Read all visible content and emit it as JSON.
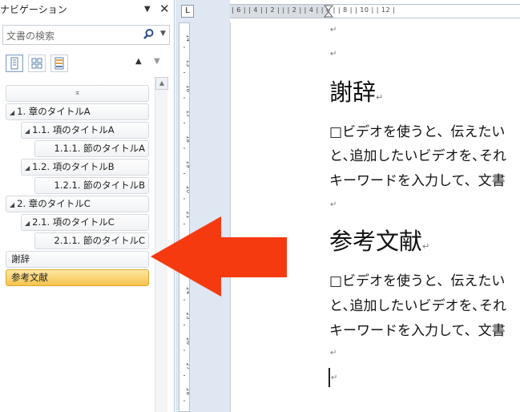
{
  "nav": {
    "title": "ナビゲーション",
    "menu_glyph": "▼",
    "close_glyph": "✕",
    "search_placeholder": "文書の検索",
    "search_drop_glyph": "▼",
    "up_glyph": "▲",
    "down_glyph": "▼",
    "collapse_glyph": "⌅",
    "scroll_up_glyph": "▲",
    "tree": [
      {
        "label": "1.  章のタイトルA",
        "expanded": true
      },
      {
        "label": "1.1.  項のタイトルA",
        "expanded": true
      },
      {
        "label": "1.1.1.  節のタイトルA"
      },
      {
        "label": "1.2.  項のタイトルB",
        "expanded": true
      },
      {
        "label": "1.2.1.  節のタイトルB"
      },
      {
        "label": "2.  章のタイトルC",
        "expanded": true
      },
      {
        "label": "2.1.  項のタイトルC",
        "expanded": true
      },
      {
        "label": "2.1.1.  節のタイトルC"
      },
      {
        "label": "謝辞"
      },
      {
        "label": "参考文献",
        "active": true
      }
    ]
  },
  "ruler": {
    "tab_selector": "L",
    "hticks": "| 6 |   | 4 |   | 2 |   |   | 2 |   | 4 |   | 6 |   | 8 |   | 10 |   | 12 |",
    "vticks": [
      "14",
      "15",
      "16",
      "17",
      "18",
      "19",
      "20",
      "21",
      "22",
      "23",
      "24",
      "25",
      "26",
      "27",
      "28"
    ]
  },
  "doc": {
    "para_mark": "↵",
    "heading1": "謝辞",
    "heading2": "参考文献",
    "line1": "□ビデオを使うと、伝えたい",
    "line2": "と､追加したいビデオを､それ",
    "line3": "キーワードを入力して、文書"
  },
  "colors": {
    "arrow": "#f53a10",
    "active_bg": "#f6c34d"
  }
}
